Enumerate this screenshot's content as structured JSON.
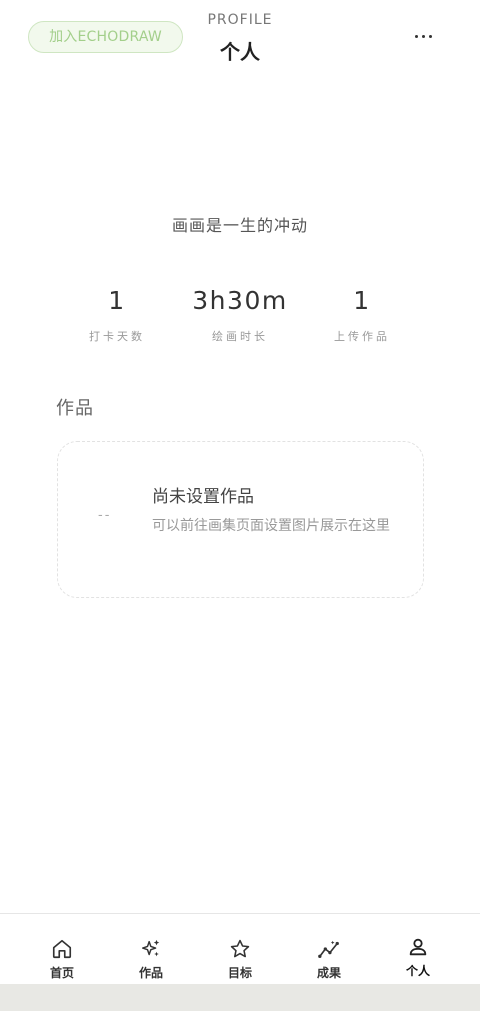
{
  "header": {
    "join_button": "加入ECHODRAW",
    "subtitle": "PROFILE",
    "title": "个人",
    "more_icon": "more-horizontal-icon"
  },
  "motto": "画画是一生的冲动",
  "stats": [
    {
      "value": "1",
      "label": "打卡天数"
    },
    {
      "value": "3h30m",
      "label": "绘画时长"
    },
    {
      "value": "1",
      "label": "上传作品"
    }
  ],
  "works": {
    "title": "作品",
    "placeholder": "--",
    "empty_title": "尚未设置作品",
    "empty_desc": "可以前往画集页面设置图片展示在这里"
  },
  "nav": [
    {
      "label": "首页",
      "icon": "home-icon"
    },
    {
      "label": "作品",
      "icon": "sparkles-icon"
    },
    {
      "label": "目标",
      "icon": "star-icon"
    },
    {
      "label": "成果",
      "icon": "trend-chart-icon"
    },
    {
      "label": "个人",
      "icon": "user-icon"
    }
  ],
  "colors": {
    "accent": "#a3cf8b",
    "accent_bg": "#f2f9ed",
    "text": "#333333",
    "muted": "#999999"
  }
}
